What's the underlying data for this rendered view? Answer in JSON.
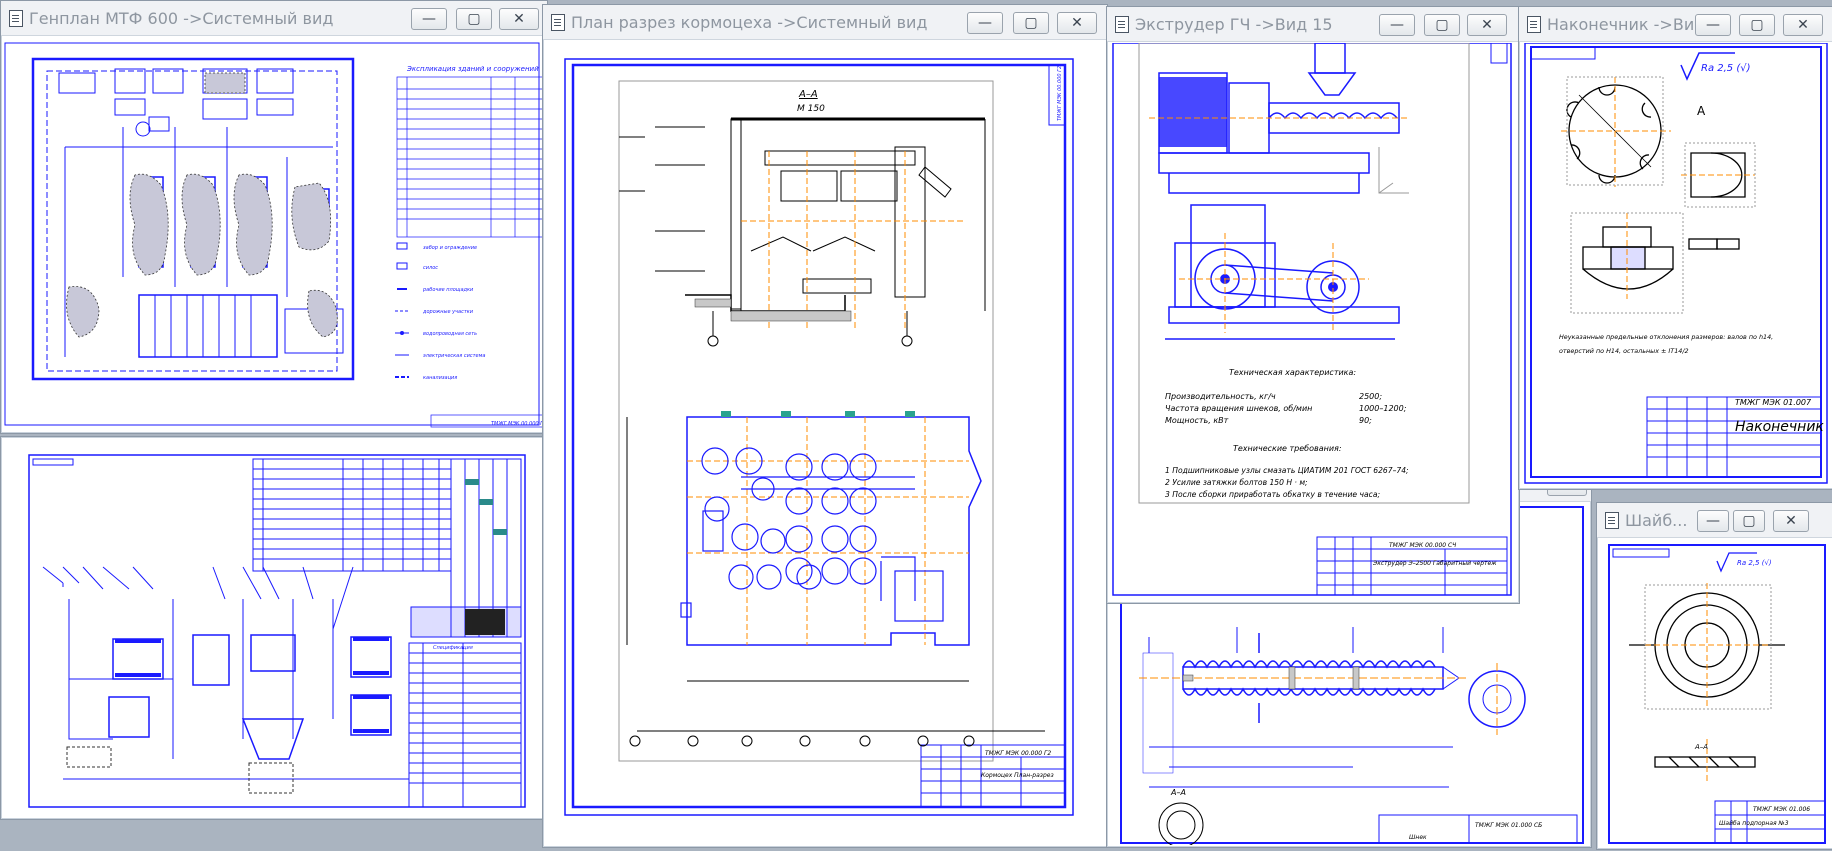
{
  "windows": {
    "genplan": {
      "title": "Генплан МТФ 600 ->Системный вид"
    },
    "plan": {
      "title": "План разрез кормоцеха ->Системный вид"
    },
    "extruder": {
      "title": "Экструдер ГЧ ->Вид 15"
    },
    "tip": {
      "title": "Наконечник ->Вид..."
    },
    "washer": {
      "title": "Шайб..."
    },
    "shaft": {
      "title": ""
    },
    "unit": {
      "title": ""
    }
  },
  "controls": {
    "minimize": "—",
    "maximize": "▢",
    "close": "✕"
  },
  "genplan": {
    "table_title": "Экспликация зданий и сооружений",
    "legend": [
      "забор и ограждение",
      "силос",
      "рабочие площадки",
      "дорожные участки",
      "водопроводная сеть",
      "электрическая система",
      "канализация"
    ],
    "stamp": "ТМЖГ МЭК 00.000 Г"
  },
  "plan": {
    "section_title": "А–А",
    "scale": "М 150",
    "stamp_code": "ТМЖГ МЭК 00.000 Г2",
    "stamp_name": "Кормоцех План-разрез",
    "side_code": "ТМЖГ МЭК 00.000 Г2"
  },
  "extruder": {
    "tech_title": "Техническая характеристика:",
    "specs": [
      {
        "label": "Производительность, кг/ч",
        "value": "2500;"
      },
      {
        "label": "Частота вращения шнеков, об/мин",
        "value": "1000–1200;"
      },
      {
        "label": "Мощность, кВт",
        "value": "90;"
      }
    ],
    "req_title": "Технические требования:",
    "reqs": [
      "1 Подшипниковые узлы смазать ЦИАТИМ 201 ГОСТ 6267–74;",
      "2 Усилие затяжки болтов 150 Н · м;",
      "3 После сборки приработать обкатку в течение часа;"
    ],
    "stamp_code": "ТМЖГ МЭК 00.000 СЧ",
    "stamp_name": "Экструдер Э–2500 Габаритный чертеж"
  },
  "tip": {
    "roughness": "Ra 2,5 (√)",
    "note1": "Неуказанные предельные отклонения размеров: валов по h14,",
    "note2": "отверстий по Н14, остальных ± IT14/2",
    "stamp_code": "ТМЖГ МЭК 01.007",
    "stamp_name": "Наконечник",
    "view_label": "А"
  },
  "washer": {
    "roughness": "Ra 2,5 (√)",
    "section": "А–А",
    "stamp_code": "ТМЖГ МЭК 01.006",
    "stamp_name": "Шайба подпорная №3"
  },
  "shaft": {
    "stamp_code": "ТМЖГ МЭК 01.000 СБ",
    "stamp_name": "Шнек",
    "section": "А–А"
  },
  "unit": {
    "title_label": "Спецификация"
  }
}
